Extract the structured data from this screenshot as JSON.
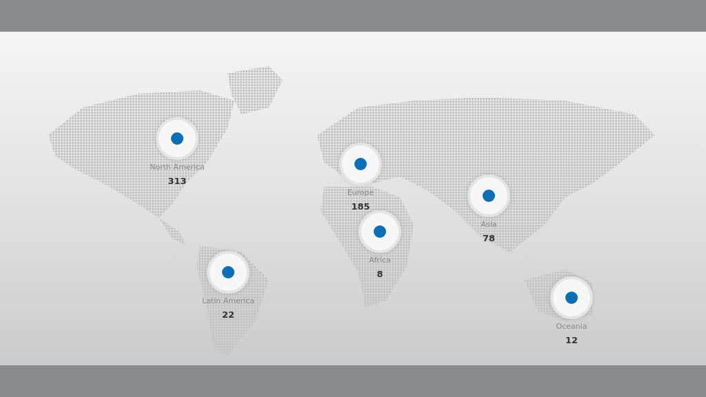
{
  "regions": [
    {
      "name": "North America",
      "value": "313"
    },
    {
      "name": "Europe",
      "value": "185"
    },
    {
      "name": "Africa",
      "value": "8"
    },
    {
      "name": "Asia",
      "value": "78"
    },
    {
      "name": "Latin America",
      "value": "22"
    },
    {
      "name": "Oceania",
      "value": "12"
    }
  ]
}
